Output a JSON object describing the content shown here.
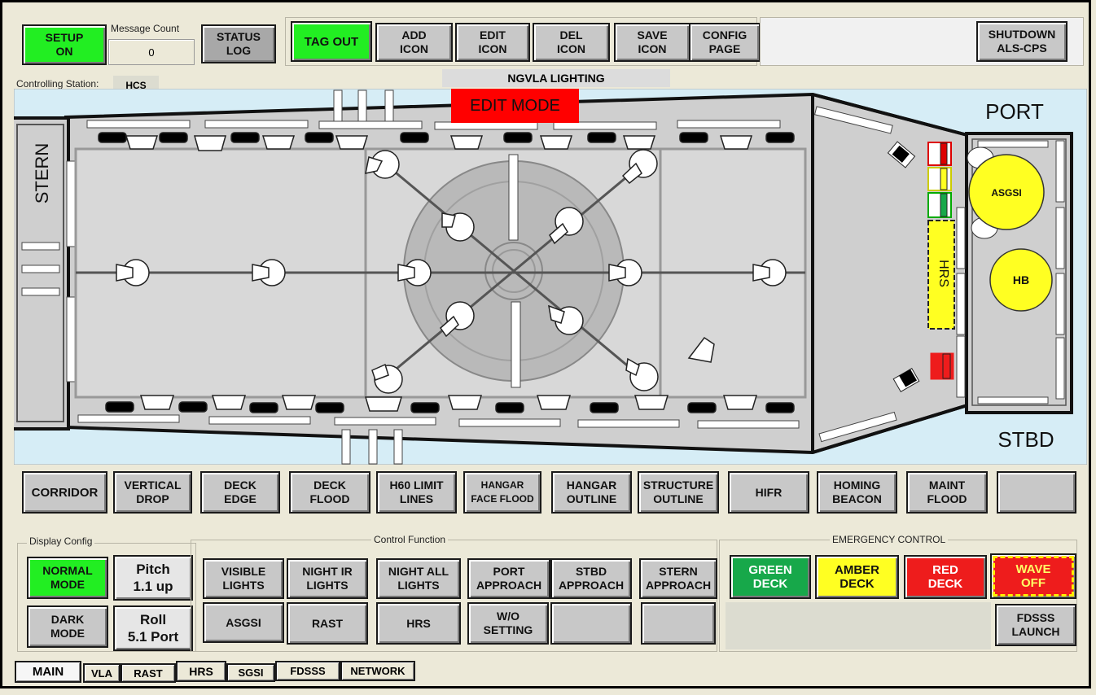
{
  "colors": {
    "background": "#ece9d8",
    "sea": "#d6edf6",
    "deck": "#cfcfcf",
    "green": "#22ee22",
    "amber": "#ffff22",
    "red": "#ee1c1c",
    "edit_mode": "#ff0000"
  },
  "top_bar": {
    "setup": "SETUP\nON",
    "message_count_label": "Message Count",
    "message_count_value": "0",
    "status_log": "STATUS\nLOG",
    "tag_out": "TAG OUT",
    "add_icon": "ADD\nICON",
    "edit_icon": "EDIT\nICON",
    "del_icon": "DEL\nICON",
    "save_icon": "SAVE\nICON",
    "config_page": "CONFIG\nPAGE",
    "shutdown": "SHUTDOWN\nALS-CPS",
    "controlling_station_label": "Controlling Station:",
    "controlling_station_value": "HCS",
    "page_title": "NGVLA LIGHTING",
    "edit_mode": "EDIT MODE"
  },
  "ship": {
    "stern_label": "STERN",
    "port_label": "PORT",
    "stbd_label": "STBD",
    "hrs_label": "HRS",
    "asgsi_label": "ASGSI",
    "hb_label": "HB"
  },
  "function_buttons": [
    "CORRIDOR",
    "VERTICAL\nDROP",
    "DECK\nEDGE",
    "DECK\nFLOOD",
    "H60 LIMIT\nLINES",
    "HANGAR\nFACE FLOOD",
    "HANGAR\nOUTLINE",
    "STRUCTURE\nOUTLINE",
    "HIFR",
    "HOMING\nBEACON",
    "MAINT\nFLOOD",
    ""
  ],
  "display_config": {
    "title": "Display Config",
    "normal_mode": "NORMAL\nMODE",
    "dark_mode": "DARK\nMODE",
    "pitch": "Pitch\n1.1 up",
    "roll": "Roll\n5.1 Port"
  },
  "control_function": {
    "title": "Control Function",
    "row1": [
      "VISIBLE\nLIGHTS",
      "NIGHT IR\nLIGHTS",
      "NIGHT ALL\nLIGHTS",
      "PORT\nAPPROACH",
      "STBD\nAPPROACH",
      "STERN\nAPPROACH"
    ],
    "row2": [
      "ASGSI",
      "RAST",
      "HRS",
      "W/O\nSETTING",
      "",
      ""
    ]
  },
  "emergency": {
    "title": "EMERGENCY CONTROL",
    "green_deck": "GREEN\nDECK",
    "amber_deck": "AMBER\nDECK",
    "red_deck": "RED\nDECK",
    "wave_off": "WAVE\nOFF",
    "fdsss_launch": "FDSSS\nLAUNCH"
  },
  "tabs": [
    "MAIN",
    "VLA",
    "RAST",
    "HRS",
    "SGSI",
    "FDSSS",
    "NETWORK"
  ]
}
